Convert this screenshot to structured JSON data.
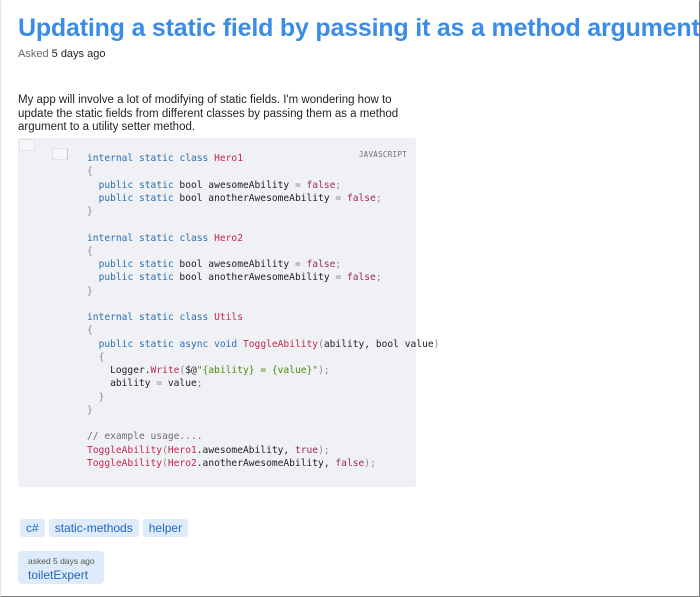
{
  "question": {
    "title": "Updating a static field by passing it as a method argument",
    "asked_label": "Asked",
    "asked_when": "5 days ago",
    "body": "My app will involve a lot of modifying of static fields. I'm wondering how to update the static fields from different classes by passing them as a method argument to a utility setter method."
  },
  "code_block": {
    "language": "JAVASCRIPT",
    "lines": [
      "internal static class Hero1",
      "{",
      "  public static bool awesomeAbility = false;",
      "  public static bool anotherAwesomeAbility = false;",
      "}",
      "",
      "internal static class Hero2",
      "{",
      "  public static bool awesomeAbility = false;",
      "  public static bool anotherAwesomeAbility = false;",
      "}",
      "",
      "internal static class Utils",
      "{",
      "  public static async void ToggleAbility(ability, bool value)",
      "  {",
      "    Logger.Write($@\"{ability} = {value}\");",
      "    ability = value;",
      "  }",
      "}",
      "",
      "// example usage....",
      "ToggleAbility(Hero1.awesomeAbility, true);",
      "ToggleAbility(Hero2.anotherAwesomeAbility, false);"
    ]
  },
  "tags": [
    "c#",
    "static-methods",
    "helper"
  ],
  "user_card": {
    "asked": "asked 5 days ago",
    "user": "toiletExpert"
  },
  "colors": {
    "title": "#3b8ce6",
    "tag_bg": "#deebfb",
    "tag_text": "#2367c2",
    "code_bg": "#f0f1f4",
    "keyword": "#2a6fb0",
    "type_name": "#c7254e",
    "literal": "#9c2a5a",
    "string": "#4f8a10",
    "comment": "#6e6e6e"
  },
  "icons": {
    "copy": "copy-icon",
    "wrap": "wrap-lines-icon"
  }
}
